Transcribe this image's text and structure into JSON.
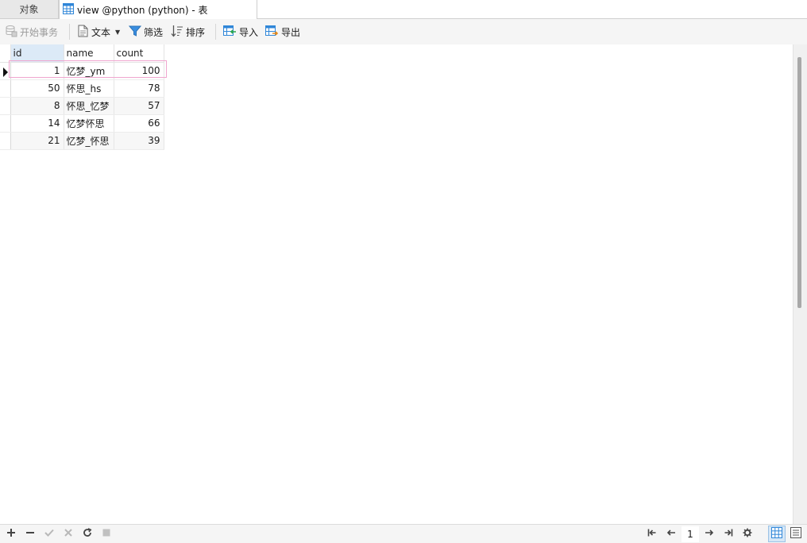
{
  "tabs": {
    "objects": "对象",
    "active": "view @python (python) - 表"
  },
  "toolbar": {
    "begin_transaction": "开始事务",
    "text": "文本",
    "filter": "筛选",
    "sort": "排序",
    "import": "导入",
    "export": "导出"
  },
  "table": {
    "columns": [
      "id",
      "name",
      "count"
    ],
    "rows": [
      {
        "id": "1",
        "name": "忆梦_ym",
        "count": "100"
      },
      {
        "id": "50",
        "name": "怀思_hs",
        "count": "78"
      },
      {
        "id": "8",
        "name": "怀思_忆梦",
        "count": "57"
      },
      {
        "id": "14",
        "name": "忆梦怀思",
        "count": "66"
      },
      {
        "id": "21",
        "name": "忆梦_怀思",
        "count": "39"
      }
    ]
  },
  "pager": {
    "page": "1"
  },
  "icons": {
    "add": "plus-icon",
    "delete": "minus-icon",
    "apply": "check-icon",
    "cancel": "x-icon",
    "refresh": "refresh-icon",
    "stop": "stop-icon",
    "first": "first-page-icon",
    "prev": "prev-page-icon",
    "next": "next-page-icon",
    "last": "last-page-icon",
    "settings": "gear-icon",
    "grid_view": "grid-view-icon",
    "form_view": "form-view-icon"
  },
  "colors": {
    "accent": "#2f86d8",
    "selection_outline": "#f0a6cf",
    "header_highlight": "#dceaf7"
  }
}
